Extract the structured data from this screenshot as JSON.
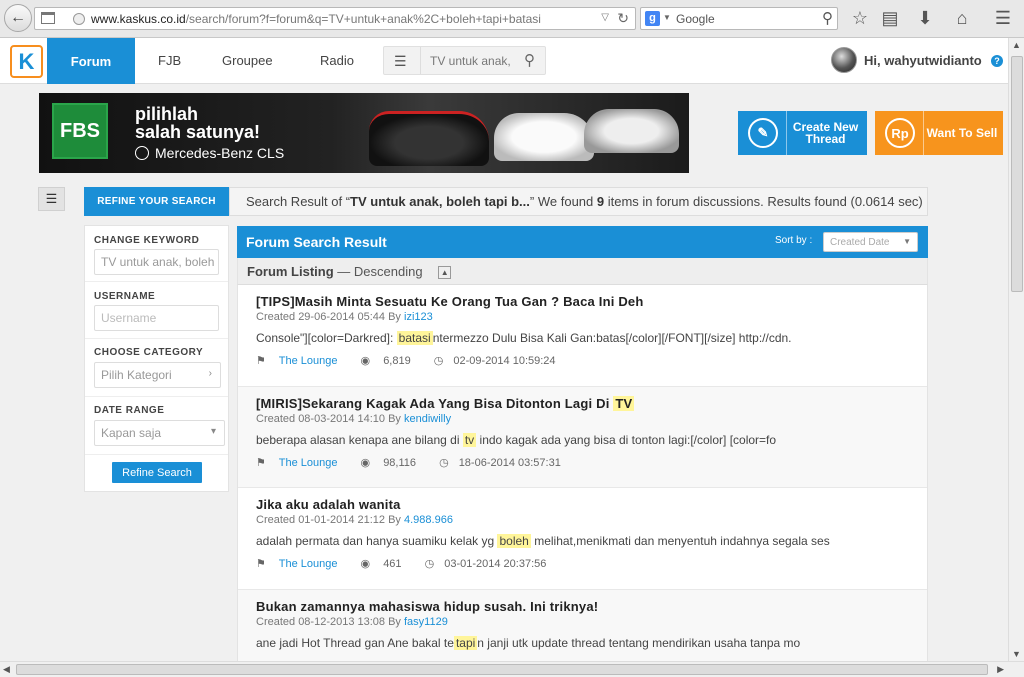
{
  "browser": {
    "url_host": "www.kaskus.co.id",
    "url_path": "/search/forum?f=forum&q=TV+untuk+anak%2C+boleh+tapi+batasi",
    "search_engine": "Google"
  },
  "nav": {
    "items": [
      "Forum",
      "FJB",
      "Groupee",
      "Radio"
    ],
    "search_value": "TV untuk anak,",
    "greeting": "Hi, wahyutwidianto"
  },
  "banner": {
    "logo": "FBS",
    "line1": "pilihlah",
    "line2": "salah satunya!",
    "brand": "Mercedes-Benz CLS"
  },
  "actions": {
    "create_label": "Create New Thread",
    "sell_label": "Want To Sell",
    "sell_badge": "Rp"
  },
  "refine": {
    "tab_label": "REFINE YOUR SEARCH",
    "keyword_label": "CHANGE KEYWORD",
    "keyword_value": "TV untuk anak, boleh",
    "username_label": "USERNAME",
    "username_placeholder": "Username",
    "category_label": "CHOOSE CATEGORY",
    "category_value": "Pilih Kategori",
    "date_label": "DATE RANGE",
    "date_value": "Kapan saja",
    "button_label": "Refine Search"
  },
  "summary": {
    "prefix": "Search Result of “",
    "query": "TV untuk anak, boleh tapi b...",
    "middle": "” We found ",
    "count": "9",
    "suffix": " items in forum discussions. Results found (0.0614 sec)"
  },
  "results": {
    "title": "Forum Search Result",
    "sort_label": "Sort by :",
    "sort_value": "Created Date",
    "listing_label": "Forum Listing",
    "listing_order": "— Descending",
    "items": [
      {
        "title": "[TIPS]Masih Minta Sesuatu Ke Orang Tua Gan ? Baca Ini Deh",
        "title_hl": "",
        "created": "Created 29-06-2014 05:44 By ",
        "author": "izi123",
        "snip_pre": "Console\"][color=Darkred]: ",
        "snip_hl": "batasi",
        "snip_post": "ntermezzo Dulu Bisa Kali Gan:batas[/color][/FONT][/size] http://cdn.",
        "forum": "The Lounge",
        "views": "6,819",
        "last": "02-09-2014 10:59:24"
      },
      {
        "title": "[MIRIS]Sekarang Kagak Ada Yang Bisa Ditonton Lagi Di ",
        "title_hl": "TV",
        "created": "Created 08-03-2014 14:10 By ",
        "author": "kendiwilly",
        "snip_pre": "beberapa alasan kenapa ane bilang di ",
        "snip_hl": "tv",
        "snip_post": " indo kagak ada yang bisa di tonton lagi:[/color] [color=fo",
        "forum": "The Lounge",
        "views": "98,116",
        "last": "18-06-2014 03:57:31"
      },
      {
        "title": "Jika aku adalah wanita",
        "title_hl": "",
        "created": "Created 01-01-2014 21:12 By ",
        "author": "4.988.966",
        "snip_pre": "adalah permata dan hanya suamiku kelak yg ",
        "snip_hl": "boleh",
        "snip_post": " melihat,menikmati dan menyentuh indahnya segala ses",
        "forum": "The Lounge",
        "views": "461",
        "last": "03-01-2014 20:37:56"
      },
      {
        "title": "Bukan zamannya mahasiswa hidup susah. Ini triknya!",
        "title_hl": "",
        "created": "Created 08-12-2013 13:08 By ",
        "author": "fasy1129",
        "snip_pre": "ane jadi Hot Thread gan Ane bakal te",
        "snip_hl": "tapi",
        "snip_post": "n janji utk update thread tentang mendirikan usaha tanpa mo",
        "forum": "",
        "views": "",
        "last": ""
      }
    ]
  }
}
